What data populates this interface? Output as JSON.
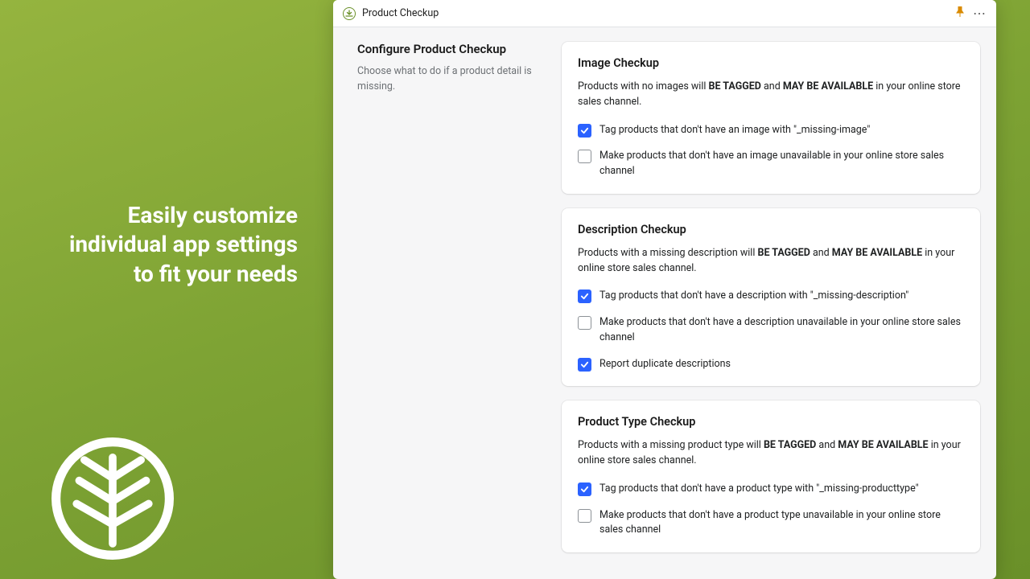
{
  "promo": {
    "line1": "Easily customize",
    "line2": "individual app settings",
    "line3": "to fit your needs"
  },
  "header": {
    "title": "Product Checkup"
  },
  "left": {
    "heading": "Configure Product Checkup",
    "sub": "Choose what to do if a product detail is missing."
  },
  "cards": [
    {
      "title": "Image Checkup",
      "desc_pre": "Products with no images will ",
      "desc_b1": "BE TAGGED",
      "desc_mid": " and ",
      "desc_b2": "MAY BE AVAILABLE",
      "desc_post": " in your online store sales channel.",
      "checks": [
        {
          "checked": true,
          "label": "Tag products that don't have an image with \"_missing-image\""
        },
        {
          "checked": false,
          "label": "Make products that don't have an image unavailable in your online store sales channel"
        }
      ]
    },
    {
      "title": "Description Checkup",
      "desc_pre": "Products with a missing description will ",
      "desc_b1": "BE TAGGED",
      "desc_mid": " and ",
      "desc_b2": "MAY BE AVAILABLE",
      "desc_post": " in your online store sales channel.",
      "checks": [
        {
          "checked": true,
          "label": "Tag products that don't have a description with \"_missing-description\""
        },
        {
          "checked": false,
          "label": "Make products that don't have a description unavailable in your online store sales channel"
        },
        {
          "checked": true,
          "label": "Report duplicate descriptions"
        }
      ]
    },
    {
      "title": "Product Type Checkup",
      "desc_pre": "Products with a missing product type will ",
      "desc_b1": "BE TAGGED",
      "desc_mid": " and ",
      "desc_b2": "MAY BE AVAILABLE",
      "desc_post": " in your online store sales channel.",
      "checks": [
        {
          "checked": true,
          "label": "Tag products that don't have a product type with \"_missing-producttype\""
        },
        {
          "checked": false,
          "label": "Make products that don't have a product type unavailable in your online store sales channel"
        }
      ]
    }
  ]
}
